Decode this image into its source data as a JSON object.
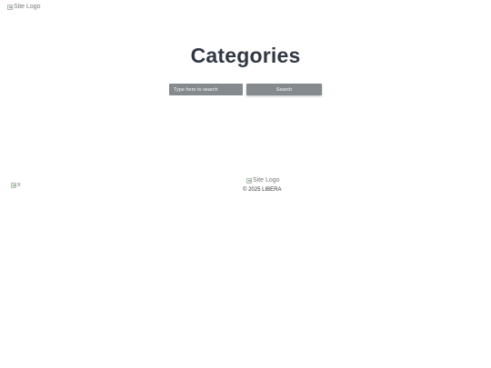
{
  "header": {
    "logo_alt": "Site Logo"
  },
  "main": {
    "title": "Categories",
    "search": {
      "placeholder": "Type here to search",
      "value": "",
      "button_label": "Search"
    },
    "side_image_alt": "x"
  },
  "footer": {
    "logo_alt": "Site Logo",
    "copyright": "© 2025 LIBERA"
  },
  "colors": {
    "title": "#323844",
    "control_background": "#848a8e",
    "control_text": "#ffffff",
    "page_background": "#ffffff"
  },
  "icons": {
    "broken_image": "broken-image-icon"
  }
}
